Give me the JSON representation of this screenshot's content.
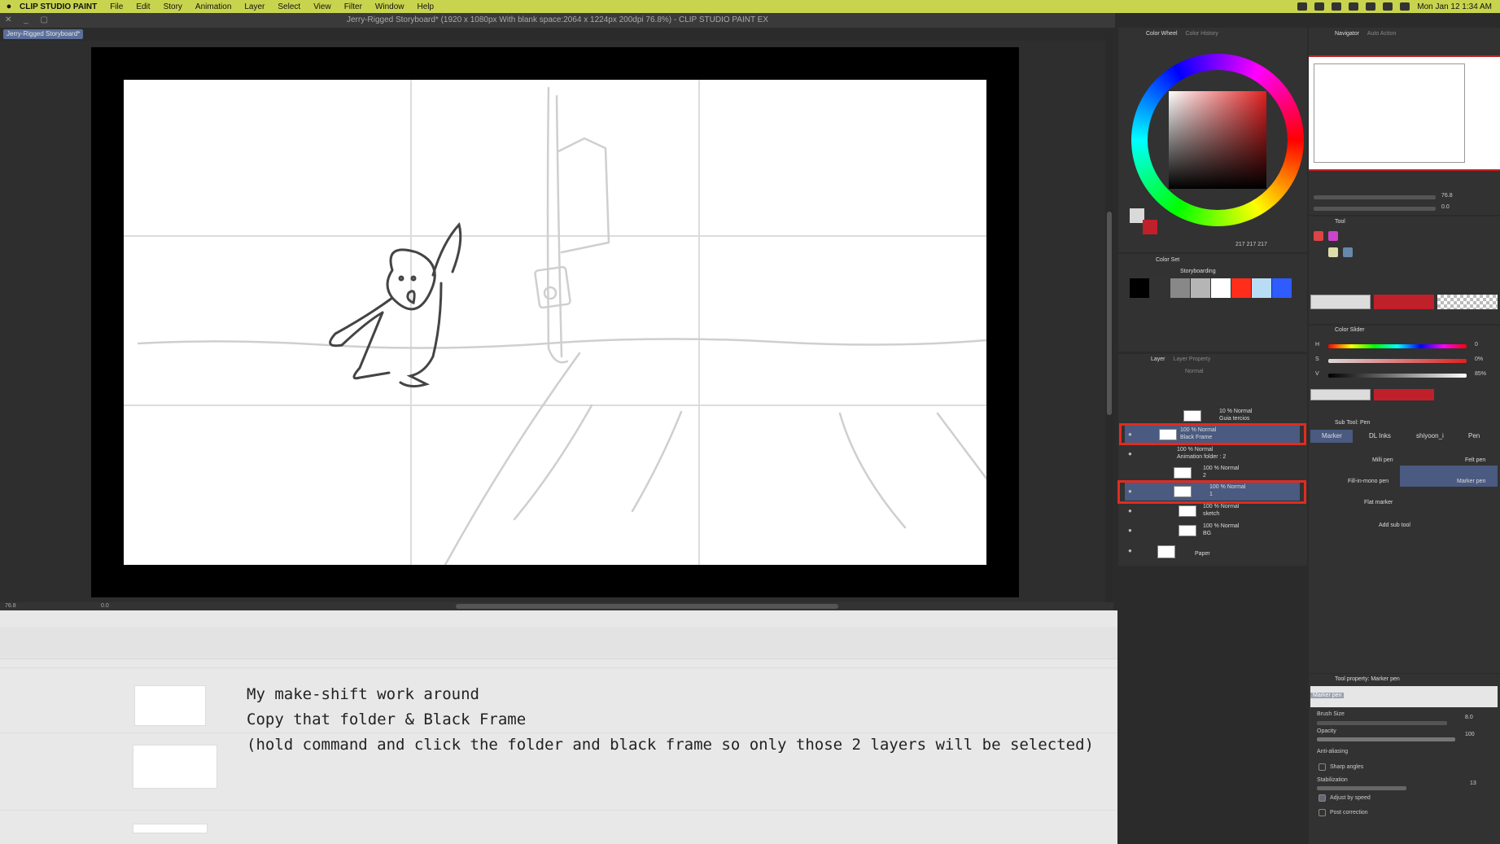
{
  "menubar": {
    "app_name": "CLIP STUDIO PAINT",
    "items": [
      "File",
      "Edit",
      "Story",
      "Animation",
      "Layer",
      "Select",
      "View",
      "Filter",
      "Window",
      "Help"
    ],
    "clock": "Mon Jan 12  1:34 AM"
  },
  "titlebar": {
    "title": "Jerry-Rigged Storyboard* (1920 x 1080px With blank space:2064 x 1224px 200dpi 76.8%)  - CLIP STUDIO PAINT EX"
  },
  "doc_tab": {
    "label": "Jerry-Rigged Storyboard*"
  },
  "statusbar": {
    "zoom": "76.8",
    "angle": "0.0"
  },
  "annotation": {
    "line1": "My make-shift work around",
    "line2": "Copy that folder & Black Frame",
    "line3": "(hold command and click the folder and black frame so only those 2 layers will be selected)"
  },
  "color_wheel": {
    "tab_active": "Color Wheel",
    "tab_inactive": "Color History",
    "rgb": "217  217  217",
    "accent": "#d9d9d9"
  },
  "color_set": {
    "title": "Color Set",
    "set_name": "Storyboarding",
    "swatches": [
      "#000000",
      "#333333",
      "#888888",
      "#b5b5b5",
      "#ffffff",
      "#ff2d1a",
      "#b9dcf5",
      "#2e5cff"
    ]
  },
  "layer_panel": {
    "tab_active": "Layer",
    "tab_inactive": "Layer Property",
    "blend_mode": "Normal",
    "layers": [
      {
        "line1": "10 % Normal",
        "line2": "Guia tercios"
      },
      {
        "line1": "100 % Normal",
        "line2": "Black Frame"
      },
      {
        "line1": "100 % Normal",
        "line2": "Animation folder : 2"
      },
      {
        "line1": "100 % Normal",
        "line2": "2"
      },
      {
        "line1": "100 % Normal",
        "line2": "1"
      },
      {
        "line1": "100 % Normal",
        "line2": "sketch"
      },
      {
        "line1": "100 % Normal",
        "line2": "BG"
      },
      {
        "line1": "",
        "line2": "Paper"
      }
    ]
  },
  "navigator": {
    "tab_active": "Navigator",
    "tab_inactive": "Auto Action",
    "zoom": "76.8",
    "angle": "0.0"
  },
  "tool_panel": {
    "title": "Tool"
  },
  "color_slider": {
    "title": "Color Slider",
    "h_label": "H",
    "s_label": "S",
    "v_label": "V",
    "h_value": "0",
    "s_value": "0%",
    "v_value": "85%",
    "mode": "HSV"
  },
  "sub_tool": {
    "title": "Sub Tool: Pen",
    "tabs": [
      "Marker",
      "DL Inks",
      "shiyoon_i",
      "Pen"
    ],
    "brushes": [
      "Milli pen",
      "Felt pen",
      "Fill-in-mono pen",
      "Marker pen",
      "Flat marker"
    ],
    "add_label": "Add sub tool"
  },
  "tool_property": {
    "title": "Tool property: Marker pen",
    "preset": "Marker pen",
    "brush_size_label": "Brush Size",
    "brush_size": "8.0",
    "opacity_label": "Opacity",
    "opacity": "100",
    "antialias_label": "Anti-aliasing",
    "sharp_label": "Sharp angles",
    "stabilization_label": "Stabilization",
    "stabilization": "13",
    "adjust_label": "Adjust by speed",
    "post_label": "Post correction"
  }
}
